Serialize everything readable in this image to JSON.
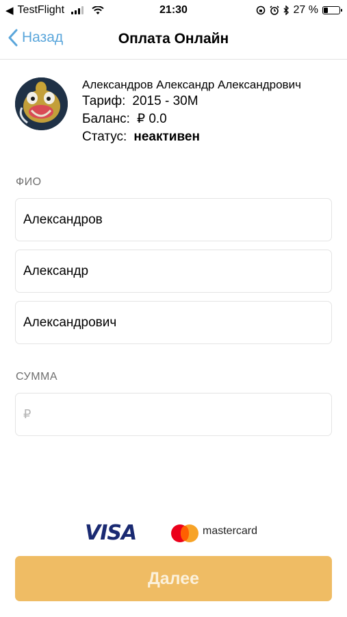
{
  "status_bar": {
    "back_app": "TestFlight",
    "time": "21:30",
    "battery": "27 %",
    "battery_level": 0.27,
    "icons": [
      "signal-icon",
      "wifi-icon",
      "orientation-lock-icon",
      "alarm-icon",
      "bluetooth-icon",
      "battery-icon"
    ]
  },
  "nav": {
    "back_label": "Назад",
    "title": "Оплата Онлайн"
  },
  "profile": {
    "name": "Александров Александр Александрович",
    "tariff_label": "Тариф:",
    "tariff_value": "2015 - 30М",
    "balance_label": "Баланс:",
    "balance_value": "₽ 0.0",
    "status_label": "Статус:",
    "status_value": "неактивен"
  },
  "form": {
    "fio_label": "ФИО",
    "last_name": "Александров",
    "first_name": "Александр",
    "middle_name": "Александрович",
    "amount_label": "СУММА",
    "amount_placeholder": "₽"
  },
  "payment": {
    "visa": "VISA",
    "mastercard": "mastercard"
  },
  "next_button": "Далее",
  "colors": {
    "accent": "#5aa6db",
    "button": "#efbc64",
    "visa": "#1a2a72"
  }
}
